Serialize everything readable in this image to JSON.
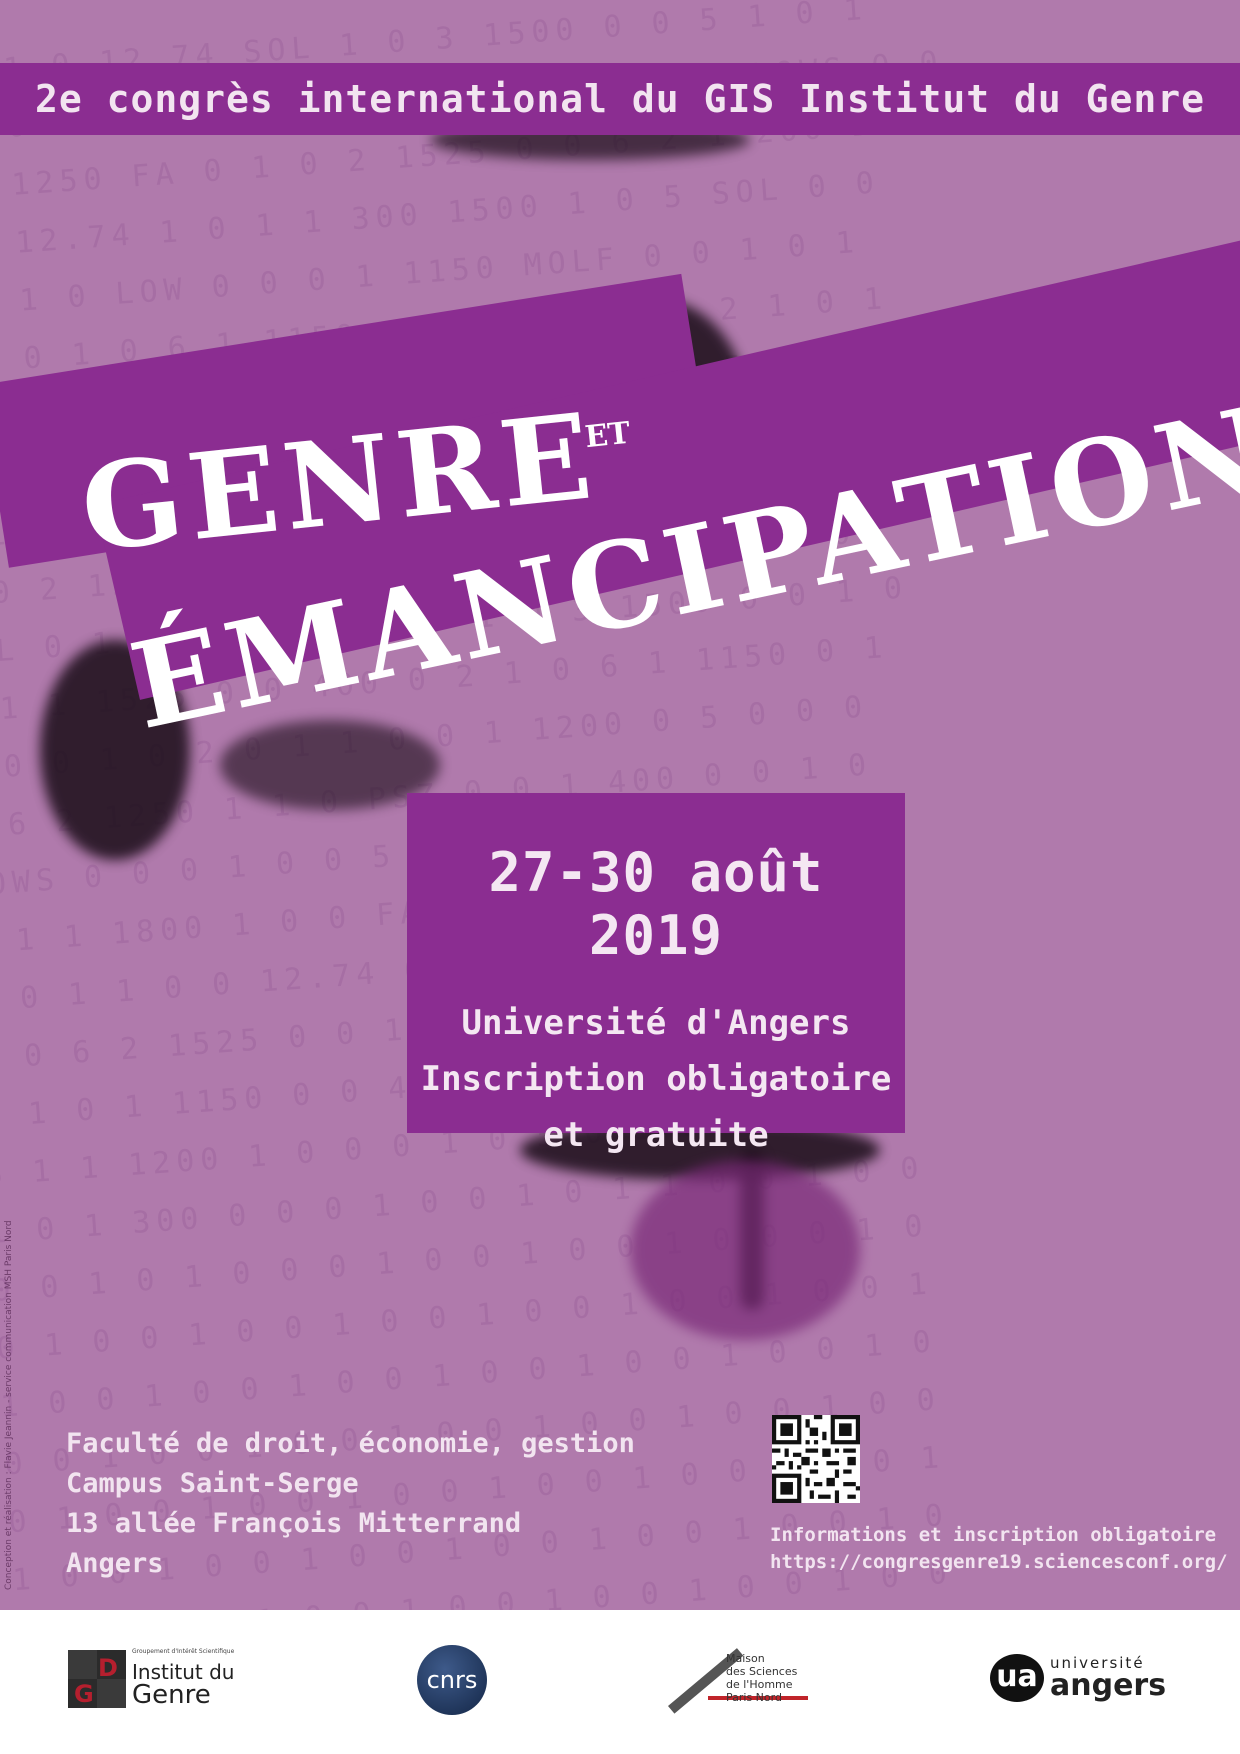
{
  "header": {
    "congress_title": "2e congrès international du GIS Institut du Genre"
  },
  "title": {
    "line1": "GENRE",
    "conjunction": "ET",
    "line2": "ÉMANCIPATION"
  },
  "event": {
    "dates": "27-30 août 2019",
    "location": "Université d'Angers",
    "registration_line1": "Inscription obligatoire",
    "registration_line2": "et gratuite"
  },
  "venue": {
    "line1": "Faculté de droit, économie, gestion",
    "line2": "Campus Saint-Serge",
    "line3": "13 allée François Mitterrand",
    "line4": "Angers"
  },
  "registration_info": {
    "label": "Informations et inscription obligatoire",
    "url": "https://congresgenre19.sciencesconf.org/"
  },
  "credit": "Conception et réalisation : Flavie Jeannin - service communication MSH Paris Nord",
  "partners": {
    "gis": {
      "subtitle": "Groupement d'Intérêt Scientifique",
      "line1": "Institut du",
      "line2": "Genre",
      "mark": "GD"
    },
    "cnrs": {
      "label": "cnrs"
    },
    "msh": {
      "line1": "Maison",
      "line2": "des Sciences",
      "line3": "de l'Homme Paris Nord"
    },
    "angers": {
      "mark": "ua",
      "line1": "université",
      "line2": "angers"
    }
  },
  "colors": {
    "background": "#b07aac",
    "band": "#8b2d91",
    "text": "#f4e7f2"
  }
}
